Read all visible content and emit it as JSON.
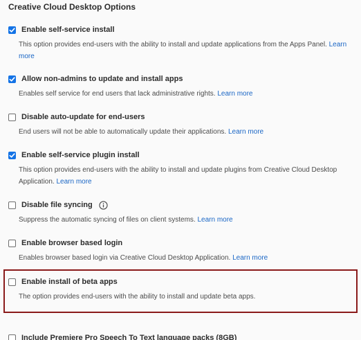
{
  "section": {
    "title": "Creative Cloud Desktop Options"
  },
  "options": [
    {
      "label": "Enable self-service install",
      "checked": true,
      "desc": "This option provides end-users with the ability to install and update applications from the Apps Panel.",
      "link": "Learn more"
    },
    {
      "label": "Allow non-admins to update and install apps",
      "checked": true,
      "desc": "Enables self service for end users that lack administrative rights.",
      "link": "Learn more"
    },
    {
      "label": "Disable auto-update for end-users",
      "checked": false,
      "desc": "End users will not be able to automatically update their applications.",
      "link": "Learn more"
    },
    {
      "label": "Enable self-service plugin install",
      "checked": true,
      "desc": "This option provides end-users with the ability to install and update plugins from Creative Cloud Desktop Application.",
      "link": "Learn more"
    },
    {
      "label": "Disable file syncing",
      "checked": false,
      "desc": "Suppress the automatic syncing of files on client systems.",
      "link": "Learn more"
    },
    {
      "label": "Enable browser based login",
      "checked": false,
      "desc": "Enables browser based login via Creative Cloud Desktop Application.",
      "link": "Learn more"
    },
    {
      "label": "Enable install of beta apps",
      "checked": false,
      "desc": "The option provides end-users with the ability to install and update beta apps."
    },
    {
      "label": "Include Premiere Pro Speech To Text language packs (8GB)",
      "checked": false
    }
  ],
  "icons": {
    "checkmark": "checkmark-icon",
    "info": "info-icon"
  },
  "colors": {
    "accent": "#1473e6",
    "link": "#1a66c5",
    "highlight_border": "#8a1a1a"
  }
}
